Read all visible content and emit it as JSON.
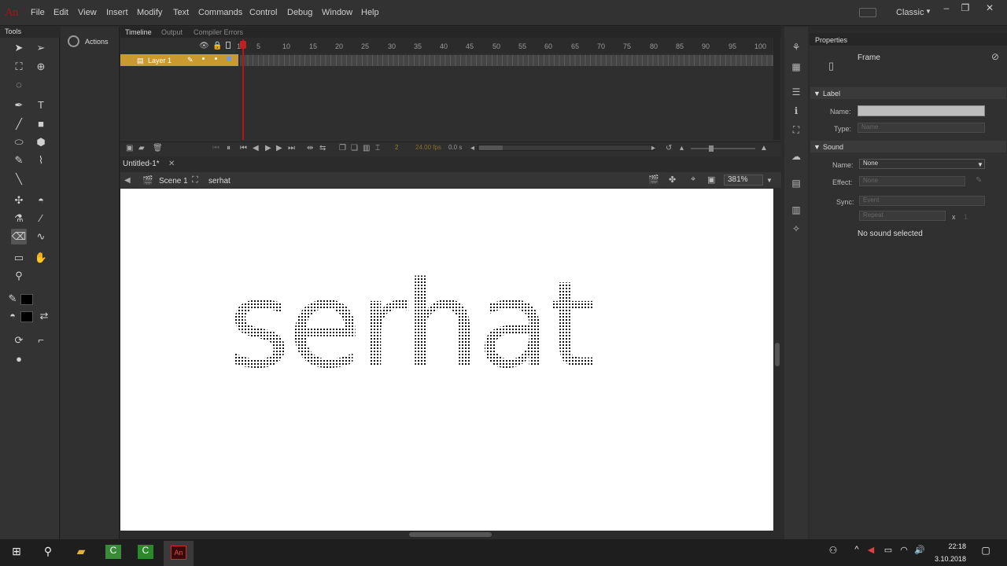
{
  "app": {
    "logo": "An",
    "title": "Adobe Animate"
  },
  "menu": [
    "File",
    "Edit",
    "View",
    "Insert",
    "Modify",
    "Text",
    "Commands",
    "Control",
    "Debug",
    "Window",
    "Help"
  ],
  "workspace": {
    "label": "Classic"
  },
  "tools": {
    "title": "Tools"
  },
  "actions": {
    "label": "Actions"
  },
  "timeline": {
    "tabs": [
      "Timeline",
      "Output",
      "Compiler Errors"
    ],
    "layer_name": "Layer 1",
    "ruler": [
      "1",
      "5",
      "10",
      "15",
      "20",
      "25",
      "30",
      "35",
      "40",
      "45",
      "50",
      "55",
      "60",
      "65",
      "70",
      "75",
      "80",
      "85",
      "90",
      "95",
      "100"
    ],
    "current_frame": "2",
    "fps": "24.00 fps",
    "time": "0.0 s"
  },
  "document": {
    "tab": "Untitled-1*",
    "scene": "Scene 1",
    "symbol": "serhat",
    "zoom": "381%",
    "stage_text": "serhat"
  },
  "properties": {
    "title": "Properties",
    "type": "Frame",
    "label_section": "Label",
    "name_label": "Name:",
    "type_label": "Type:",
    "type_value": "Name",
    "sound_section": "Sound",
    "sound_name_label": "Name:",
    "sound_name_value": "None",
    "effect_label": "Effect:",
    "effect_value": "None",
    "sync_label": "Sync:",
    "sync_value": "Event",
    "repeat_value": "Repeat",
    "repeat_x": "x",
    "repeat_count": "1",
    "no_sound": "No sound selected"
  },
  "taskbar": {
    "time": "22:18",
    "date": "3.10.2018"
  },
  "colors": {
    "accent_layer": "#c99a30",
    "playhead": "#b01818",
    "logo": "#a01818"
  }
}
